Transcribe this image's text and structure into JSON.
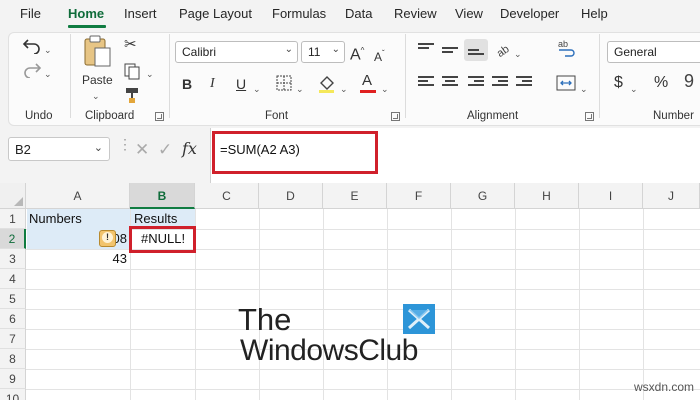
{
  "menu": {
    "tabs": [
      "File",
      "Home",
      "Insert",
      "Page Layout",
      "Formulas",
      "Data",
      "Review",
      "View",
      "Developer",
      "Help"
    ],
    "active": "Home"
  },
  "ribbon": {
    "groups": {
      "undo": "Undo",
      "clipboard": "Clipboard",
      "font": "Font",
      "alignment": "Alignment",
      "number": "Number"
    },
    "paste_label": "Paste",
    "font_name": "Calibri",
    "font_size": "11",
    "grow_font": "A",
    "shrink_font": "A",
    "bold": "B",
    "italic": "I",
    "underline": "U",
    "font_color_letter": "A",
    "font_color": "#e02020",
    "number_format": "General",
    "currency": "$",
    "percent": "%",
    "comma": "9"
  },
  "formula_bar": {
    "name_box": "B2",
    "fx": "fx",
    "formula": "=SUM(A2 A3)"
  },
  "sheet": {
    "columns": [
      "A",
      "B",
      "C",
      "D",
      "E",
      "F",
      "G",
      "H",
      "I",
      "J"
    ],
    "selected_column": "B",
    "rows": [
      "1",
      "2",
      "3",
      "4",
      "5",
      "6",
      "7",
      "8",
      "9",
      "10"
    ],
    "selected_row": "2",
    "cells": {
      "A1": "Numbers",
      "B1": "Results",
      "A2_visible": "08",
      "B2": "#NULL!",
      "A3": "43"
    },
    "error_indicator": "!"
  },
  "watermark": {
    "line1": "The",
    "line2": "WindowsClub",
    "site": "wsxdn.com"
  },
  "colors": {
    "excel_green": "#107c41",
    "highlight_red": "#d0202b",
    "table_blue": "#ddebf7",
    "logo_blue": "#2d95d8"
  }
}
